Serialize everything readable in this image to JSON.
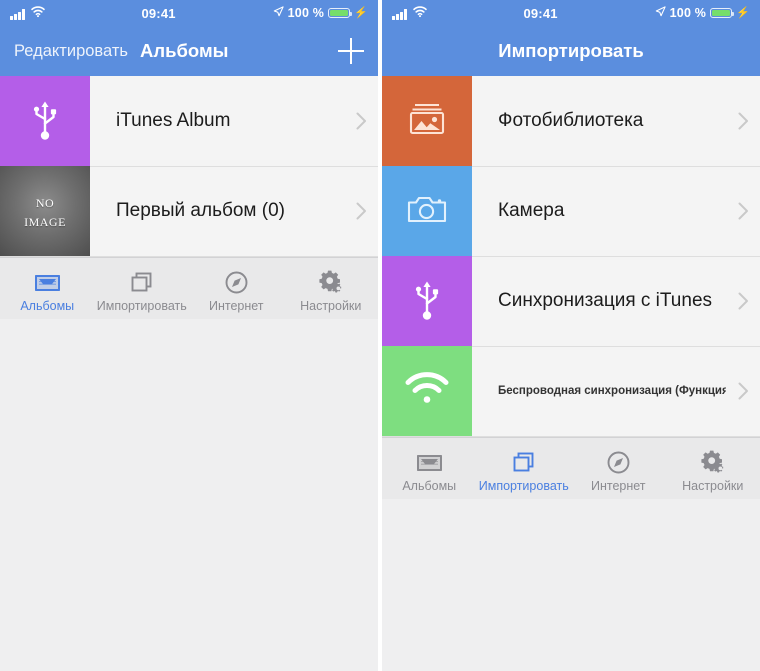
{
  "colors": {
    "nav_blue": "#5b8ede",
    "accent_blue": "#4a7fe0",
    "purple": "#b45ee8",
    "orange": "#d4663a",
    "camera_blue": "#5aa7e8",
    "green": "#7ede80",
    "list_bg": "#f4f4f4",
    "tab_inactive": "#8b8b90"
  },
  "status_bar": {
    "signal_icon": "signal-bars-icon",
    "wifi_icon": "wifi-icon",
    "time": "09:41",
    "location_icon": "location-arrow-icon",
    "battery_percent": "100 %",
    "battery_icon": "battery-icon",
    "charging_icon": "charging-bolt-icon"
  },
  "left_phone": {
    "nav": {
      "edit_label": "Редактировать",
      "title": "Альбомы",
      "add_icon": "plus-icon"
    },
    "rows": [
      {
        "label": "iTunes Album",
        "thumb_type": "usb",
        "thumb_icon": "usb-icon",
        "chevron_icon": "chevron-right-icon"
      },
      {
        "label": "Первый альбом (0)",
        "thumb_type": "noimage",
        "thumb_text_line1": "No",
        "thumb_text_line2": "Image",
        "chevron_icon": "chevron-right-icon"
      }
    ],
    "tabs": [
      {
        "label": "Альбомы",
        "icon": "tray-icon",
        "active": true
      },
      {
        "label": "Импортировать",
        "icon": "copy-icon",
        "active": false
      },
      {
        "label": "Интернет",
        "icon": "compass-icon",
        "active": false
      },
      {
        "label": "Настройки",
        "icon": "gears-icon",
        "active": false
      }
    ]
  },
  "right_phone": {
    "nav": {
      "title": "Импортировать"
    },
    "rows": [
      {
        "label": "Фотобиблиотека",
        "thumb_type": "photo",
        "thumb_icon": "photo-library-icon",
        "chevron_icon": "chevron-right-icon",
        "small": false
      },
      {
        "label": "Камера",
        "thumb_type": "camera",
        "thumb_icon": "camera-icon",
        "chevron_icon": "chevron-right-icon",
        "small": false
      },
      {
        "label": "Синхронизация с iTunes",
        "thumb_type": "usb",
        "thumb_icon": "usb-icon",
        "chevron_icon": "chevron-right-icon",
        "small": false
      },
      {
        "label": "Беспроводная синхронизация (Функция Premium)",
        "thumb_type": "wifi",
        "thumb_icon": "wifi-sync-icon",
        "chevron_icon": "chevron-right-icon",
        "small": true
      }
    ],
    "tabs": [
      {
        "label": "Альбомы",
        "icon": "tray-icon",
        "active": false
      },
      {
        "label": "Импортировать",
        "icon": "copy-icon",
        "active": true
      },
      {
        "label": "Интернет",
        "icon": "compass-icon",
        "active": false
      },
      {
        "label": "Настройки",
        "icon": "gears-icon",
        "active": false
      }
    ]
  }
}
